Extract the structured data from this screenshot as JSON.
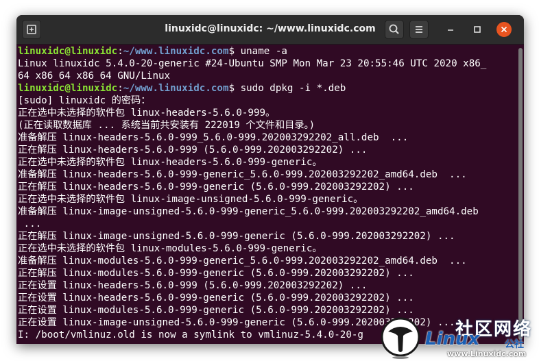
{
  "window": {
    "title": "linuxidc@linuxidc: ~/www.linuxidc.com"
  },
  "titlebar": {
    "icons": [
      "new-tab-icon",
      "search-icon",
      "hamburger-menu-icon",
      "minimize-icon",
      "maximize-icon",
      "close-icon"
    ]
  },
  "colors": {
    "terminal_bg": "#300a24",
    "prompt_user": "#8ae234",
    "prompt_path": "#729fcf",
    "text": "#ffffff",
    "close_button": "#e95420"
  },
  "terminal": {
    "lines": [
      {
        "user": "linuxidc@linuxidc",
        "sep": ":",
        "path": "~/www.linuxidc.com",
        "end": "$ uname -a"
      },
      {
        "text": "Linux linuxidc 5.4.0-20-generic #24-Ubuntu SMP Mon Mar 23 20:55:46 UTC 2020 x86_"
      },
      {
        "text": "64 x86_64 x86_64 GNU/Linux"
      },
      {
        "user": "linuxidc@linuxidc",
        "sep": ":",
        "path": "~/www.linuxidc.com",
        "end": "$ sudo dpkg -i *.deb"
      },
      {
        "text": "[sudo] linuxidc 的密码："
      },
      {
        "text": "正在选中未选择的软件包 linux-headers-5.6.0-999。"
      },
      {
        "text": "(正在读取数据库 ... 系统当前共安装有 222019 个文件和目录。)"
      },
      {
        "text": "准备解压 linux-headers-5.6.0-999_5.6.0-999.202003292202_all.deb  ..."
      },
      {
        "text": "正在解压 linux-headers-5.6.0-999 (5.6.0-999.202003292202) ..."
      },
      {
        "text": "正在选中未选择的软件包 linux-headers-5.6.0-999-generic。"
      },
      {
        "text": "准备解压 linux-headers-5.6.0-999-generic_5.6.0-999.202003292202_amd64.deb  ..."
      },
      {
        "text": "正在解压 linux-headers-5.6.0-999-generic (5.6.0-999.202003292202) ..."
      },
      {
        "text": "正在选中未选择的软件包 linux-image-unsigned-5.6.0-999-generic。"
      },
      {
        "text": "准备解压 linux-image-unsigned-5.6.0-999-generic_5.6.0-999.202003292202_amd64.deb"
      },
      {
        "text": " ..."
      },
      {
        "text": "正在解压 linux-image-unsigned-5.6.0-999-generic (5.6.0-999.202003292202) ..."
      },
      {
        "text": "正在选中未选择的软件包 linux-modules-5.6.0-999-generic。"
      },
      {
        "text": "准备解压 linux-modules-5.6.0-999-generic_5.6.0-999.202003292202_amd64.deb  ..."
      },
      {
        "text": "正在解压 linux-modules-5.6.0-999-generic (5.6.0-999.202003292202) ..."
      },
      {
        "text": "正在设置 linux-headers-5.6.0-999 (5.6.0-999.202003292202) ..."
      },
      {
        "text": "正在设置 linux-headers-5.6.0-999-generic (5.6.0-999.202003292202) ..."
      },
      {
        "text": "正在设置 linux-modules-5.6.0-999-generic (5.6.0-999.202003292202) ..."
      },
      {
        "text": "正在设置 linux-image-unsigned-5.6.0-999-generic (5.6.0-999.202003292202) ..."
      },
      {
        "text": "I: /boot/vmlinuz.old is now a symlink to vmlinuz-5.4.0-20-g"
      }
    ]
  },
  "watermark": {
    "cn_title": "社区网络",
    "brand": "Linux",
    "community": "公社",
    "url": "www.Linuxidc.com"
  }
}
